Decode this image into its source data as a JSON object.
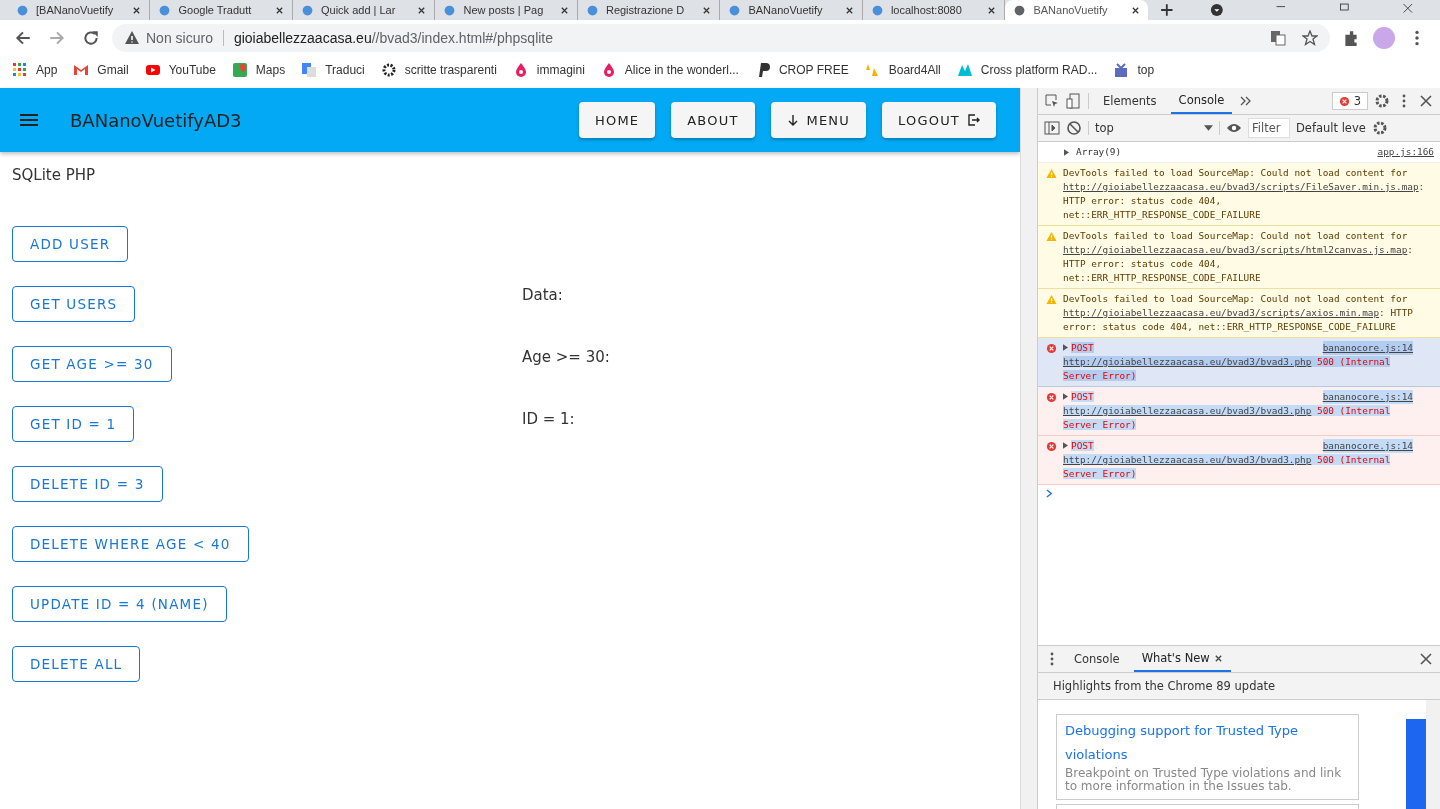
{
  "browser": {
    "tabs": [
      {
        "title": "[BANanoVuetify",
        "selected": false
      },
      {
        "title": "Google Tradutt",
        "selected": false
      },
      {
        "title": "Quick add | Lar",
        "selected": false
      },
      {
        "title": "New posts | Pag",
        "selected": false
      },
      {
        "title": "Registrazione D",
        "selected": false
      },
      {
        "title": "BANanoVuetify",
        "selected": false
      },
      {
        "title": "localhost:8080",
        "selected": false
      },
      {
        "title": "BANanoVuetify",
        "selected": true
      }
    ],
    "security": "Non sicuro",
    "url_host": "gioiabellezzaacasa.eu",
    "url_path": "//bvad3/index.html#/phpsqlite",
    "bookmarks": [
      "App",
      "Gmail",
      "YouTube",
      "Maps",
      "Traduci",
      "scritte trasparenti",
      "immagini",
      "Alice in the wonderl...",
      "CROP FREE",
      "Board4All",
      "Cross platform RAD...",
      "top"
    ]
  },
  "app_bar": {
    "title": "BANanoVuetifyAD3",
    "buttons": [
      {
        "label": "HOME"
      },
      {
        "label": "ABOUT"
      },
      {
        "label": "MENU"
      },
      {
        "label": "LOGOUT"
      }
    ]
  },
  "page": {
    "heading": "SQLite PHP",
    "actions": [
      "ADD USER",
      "GET USERS",
      "GET AGE >= 30",
      "GET ID = 1",
      "DELETE ID = 3",
      "DELETE WHERE AGE < 40",
      "UPDATE ID = 4 (NAME)",
      "DELETE ALL"
    ],
    "results": [
      "Data:",
      "Age >= 30:",
      "ID = 1:"
    ]
  },
  "devtools": {
    "tabs": [
      {
        "label": "Elements",
        "selected": false
      },
      {
        "label": "Console",
        "selected": true
      }
    ],
    "error_count": "3",
    "context": "top",
    "filter_placeholder": "Filter",
    "levels": "Default leve",
    "messages": [
      {
        "kind": "log",
        "text": "Array(9)",
        "source": "app.js:166"
      },
      {
        "kind": "warning",
        "before": "DevTools failed to load SourceMap: Could not load content for ",
        "link": [
          "http://gioiabellezzaacasa.eu/bvad3/script",
          "s/FileSaver.min.js.map"
        ],
        "after": ": HTTP error: status code 404, net::ERR_HTTP_RESPONSE_CODE_FAILURE"
      },
      {
        "kind": "warning",
        "before": "DevTools failed to load SourceMap: Could not load content for ",
        "link": [
          "http://gioiabellezzaacasa.eu/bvad3/script",
          "s/html2canvas.js.map"
        ],
        "after": ": HTTP error: status code 404, net::ERR_HTTP_RESPONSE_CODE_FAILURE"
      },
      {
        "kind": "warning",
        "before": "DevTools failed to load SourceMap: Could not load content for ",
        "link": [
          "http://gioiabellezzaacasa.eu/bvad3/script",
          "s/axios.min.map"
        ],
        "after": ": HTTP error: status code 404, net::ERR_HTTP_RESPONSE_CODE_FAILURE"
      },
      {
        "kind": "error",
        "before": "POST ",
        "link": [
          "http://gioiabellezzaacasa.eu/",
          "bvad3/bvad3.php"
        ],
        "after": " 500 (Internal Server Error)",
        "source": "bananocore.js:14",
        "selected": true
      },
      {
        "kind": "error",
        "before": "POST ",
        "link": [
          "http://gioiabellezzaacasa.eu/",
          "bvad3/bvad3.php"
        ],
        "after": " 500 (Internal Server Error)",
        "source": "bananocore.js:14",
        "selected": false
      },
      {
        "kind": "error",
        "before": "POST ",
        "link": [
          "http://gioiabellezzaacasa.eu/",
          "bvad3/bvad3.php"
        ],
        "after": " 500 (Internal Server Error)",
        "source": "bananocore.js:14",
        "selected": false
      }
    ],
    "drawer": {
      "tabs": [
        {
          "label": "Console",
          "selected": false
        },
        {
          "label": "What's New",
          "selected": true
        }
      ],
      "header": "Highlights from the Chrome 89 update",
      "card": {
        "title": "Debugging support for Trusted Type violations",
        "text": "Breakpoint on Trusted Type violations and link to more information in the Issues tab."
      }
    }
  }
}
